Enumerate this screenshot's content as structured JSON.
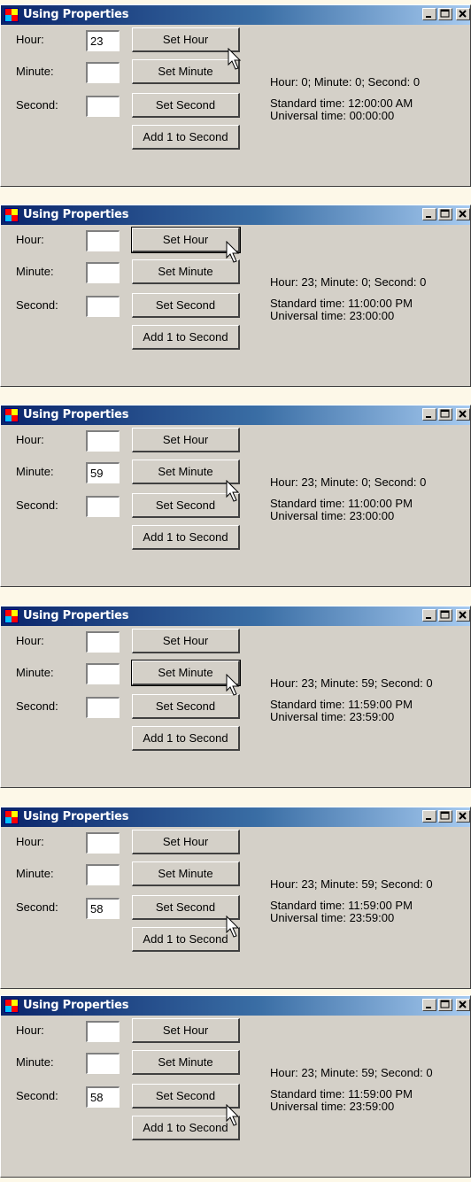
{
  "frames": [
    {
      "title": "Using Properties",
      "hour_label": "Hour:",
      "minute_label": "Minute:",
      "second_label": "Second:",
      "hour_value": "23",
      "minute_value": "",
      "second_value": "",
      "set_hour": "Set Hour",
      "set_minute": "Set Minute",
      "set_second": "Set Second",
      "add_second": "Add 1 to Second",
      "time_info": "Hour: 0; Minute: 0; Second: 0",
      "standard_time": "Standard time: 12:00:00  AM",
      "universal_time": "Universal time: 00:00:00"
    },
    {
      "title": "Using Properties",
      "hour_label": "Hour:",
      "minute_label": "Minute:",
      "second_label": "Second:",
      "hour_value": "",
      "minute_value": "",
      "second_value": "",
      "set_hour": "Set Hour",
      "set_minute": "Set Minute",
      "set_second": "Set Second",
      "add_second": "Add 1 to Second",
      "time_info": "Hour: 23; Minute: 0; Second: 0",
      "standard_time": "Standard time: 11:00:00  PM",
      "universal_time": "Universal time: 23:00:00"
    },
    {
      "title": "Using Properties",
      "hour_label": "Hour:",
      "minute_label": "Minute:",
      "second_label": "Second:",
      "hour_value": "",
      "minute_value": "59",
      "second_value": "",
      "set_hour": "Set Hour",
      "set_minute": "Set Minute",
      "set_second": "Set Second",
      "add_second": "Add 1 to Second",
      "time_info": "Hour: 23; Minute: 0; Second: 0",
      "standard_time": "Standard time: 11:00:00  PM",
      "universal_time": "Universal time: 23:00:00"
    },
    {
      "title": "Using Properties",
      "hour_label": "Hour:",
      "minute_label": "Minute:",
      "second_label": "Second:",
      "hour_value": "",
      "minute_value": "",
      "second_value": "",
      "set_hour": "Set Hour",
      "set_minute": "Set Minute",
      "set_second": "Set Second",
      "add_second": "Add 1 to Second",
      "time_info": "Hour: 23; Minute: 59; Second: 0",
      "standard_time": "Standard time: 11:59:00  PM",
      "universal_time": "Universal time: 23:59:00"
    },
    {
      "title": "Using Properties",
      "hour_label": "Hour:",
      "minute_label": "Minute:",
      "second_label": "Second:",
      "hour_value": "",
      "minute_value": "",
      "second_value": "58",
      "set_hour": "Set Hour",
      "set_minute": "Set Minute",
      "set_second": "Set Second",
      "add_second": "Add 1 to Second",
      "time_info": "Hour: 23; Minute: 59; Second: 0",
      "standard_time": "Standard time: 11:59:00  PM",
      "universal_time": "Universal time: 23:59:00"
    },
    {
      "title": "Using Properties",
      "hour_label": "Hour:",
      "minute_label": "Minute:",
      "second_label": "Second:",
      "hour_value": "",
      "minute_value": "",
      "second_value": "58",
      "set_hour": "Set Hour",
      "set_minute": "Set Minute",
      "set_second": "Set Second",
      "add_second": "Add 1 to Second",
      "time_info": "Hour: 23; Minute: 59; Second: 0",
      "standard_time": "Standard time: 11:59:00  PM",
      "universal_time": "Universal time: 23:59:00"
    }
  ],
  "colors": {
    "window_face": "#d4d0c8",
    "title_start": "#0a246a",
    "title_end": "#a6caf0",
    "page_bg": "#fdf8e8"
  },
  "icons": {
    "app": "app-icon",
    "minimize": "minimize-icon",
    "maximize": "maximize-icon",
    "close": "close-icon",
    "cursor": "mouse-pointer-icon"
  }
}
